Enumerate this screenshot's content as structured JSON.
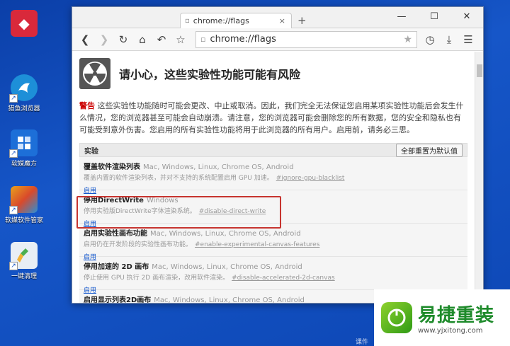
{
  "desktop": {
    "icons": [
      {
        "label": "",
        "icon": "app-icon",
        "color": "#d9293b"
      },
      {
        "label": "猎鱼浏览器",
        "icon": "fish-browser-icon",
        "color": "#1d8fd8"
      },
      {
        "label": "软媒魔方",
        "icon": "cube-icon",
        "color": "#1d6fd8"
      },
      {
        "label": "软媒软件管家",
        "icon": "software-manager-icon",
        "color": "#e8a11d"
      },
      {
        "label": "一键清理",
        "icon": "broom-icon",
        "color": "#4caf50"
      }
    ],
    "taskbar_text": "课件"
  },
  "browser": {
    "tab_title": "chrome://flags",
    "tab_close": "×",
    "new_tab": "+",
    "window_controls": {
      "minimize": "—",
      "maximize": "☐",
      "close": "✕"
    },
    "address": "chrome://flags"
  },
  "page": {
    "title": "请小心，这些实验性功能可能有风险",
    "warning_label": "警告",
    "warning_text": "这些实验性功能随时可能会更改、中止或取消。因此，我们完全无法保证您启用某项实验性功能后会发生什么情况，您的浏览器甚至可能会自动崩溃。请注意，您的浏览器可能会删除您的所有数据，您的安全和隐私也有可能受到意外伤害。您启用的所有实验性功能将用于此浏览器的所有用户。启用前，请务必三思。",
    "section_title": "实验",
    "reset_button": "全部重置为默认值",
    "experiments": [
      {
        "name": "覆盖软件渲染列表",
        "platforms": "Mac, Windows, Linux, Chrome OS, Android",
        "desc": "覆盖内置的软件渲染列表，并对不支持的系统配置启用 GPU 加速。",
        "anchor": "#ignore-gpu-blacklist",
        "link": "启用"
      },
      {
        "name": "停用DirectWrite",
        "platforms": "Windows",
        "desc": "停用实验版DirectWrite字体渲染系统。",
        "anchor": "#disable-direct-write",
        "link": "启用"
      },
      {
        "name": "启用实验性画布功能",
        "platforms": "Mac, Windows, Linux, Chrome OS, Android",
        "desc": "启用仍在开发阶段的实验性画布功能。",
        "anchor": "#enable-experimental-canvas-features",
        "link": "启用"
      },
      {
        "name": "停用加速的 2D 画布",
        "platforms": "Mac, Windows, Linux, Chrome OS, Android",
        "desc": "停止使用 GPU 执行 2D 画布渲染，改用软件渲染。",
        "anchor": "#disable-accelerated-2d-canvas",
        "link": "启用"
      },
      {
        "name": "启用显示列表2D画布",
        "platforms": "Mac, Windows, Linux, Chrome OS, Android",
        "desc": "",
        "anchor": "",
        "link": ""
      }
    ]
  },
  "logo": {
    "name": "易捷重装",
    "url": "www.yjxitong.com"
  }
}
